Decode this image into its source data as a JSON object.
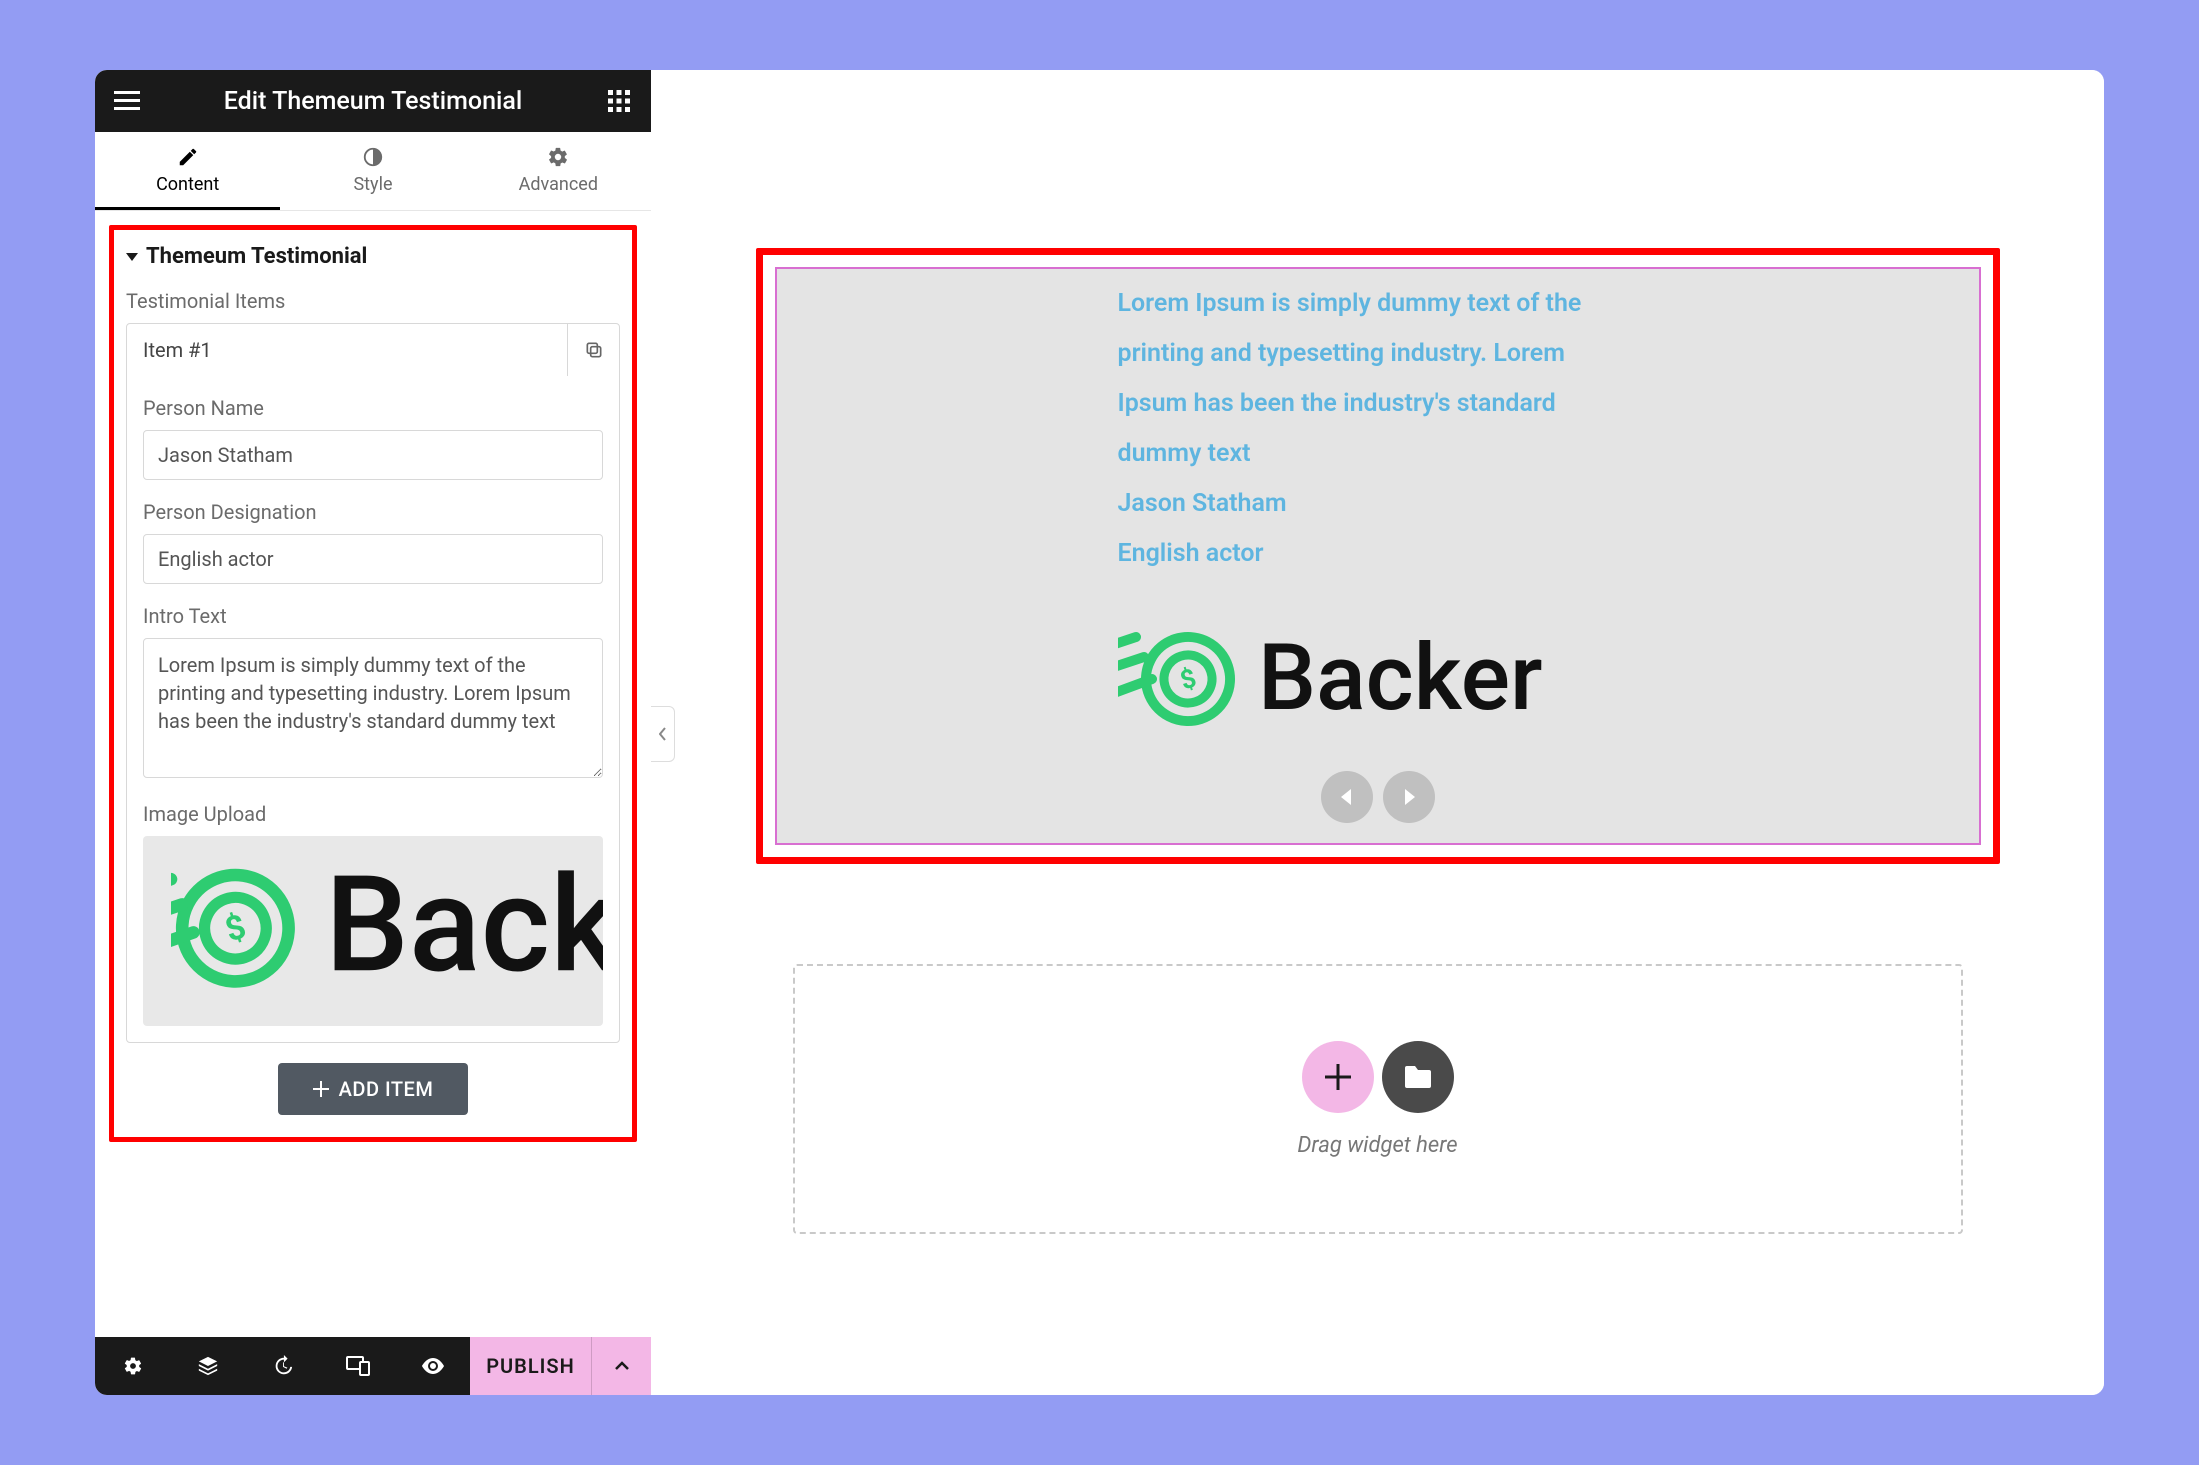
{
  "header": {
    "title": "Edit Themeum Testimonial"
  },
  "tabs": {
    "content": "Content",
    "style": "Style",
    "advanced": "Advanced"
  },
  "section": {
    "title": "Themeum Testimonial",
    "items_label": "Testimonial Items"
  },
  "item": {
    "title": "Item #1",
    "person_name_label": "Person Name",
    "person_name_value": "Jason Statham",
    "designation_label": "Person Designation",
    "designation_value": "English actor",
    "intro_label": "Intro Text",
    "intro_value": "Lorem Ipsum is simply dummy text of the printing and typesetting industry. Lorem Ipsum has been the industry's standard dummy text",
    "image_label": "Image Upload"
  },
  "add_item": "ADD ITEM",
  "bottom": {
    "publish": "PUBLISH"
  },
  "preview": {
    "intro": "Lorem Ipsum is simply dummy text of the printing and typesetting industry. Lorem Ipsum has been the industry's standard dummy text",
    "name": "Jason Statham",
    "designation": "English actor",
    "logo_text": "Backer"
  },
  "dropzone": {
    "text": "Drag widget here"
  }
}
